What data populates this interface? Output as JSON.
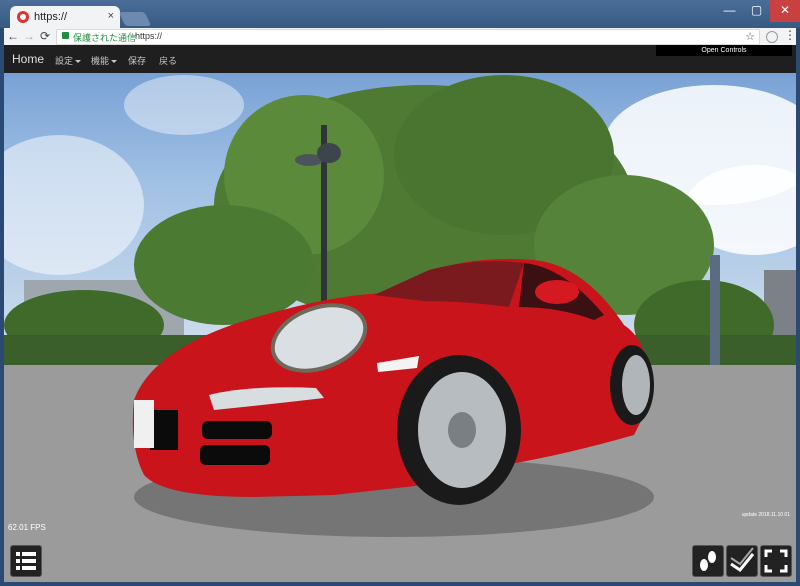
{
  "browser": {
    "tab_title": "https://",
    "tab_close": "×",
    "window_controls": {
      "minimize": "—",
      "maximize": "▢",
      "close": "✕"
    },
    "nav": {
      "back": "←",
      "forward": "→",
      "reload": "⟳"
    },
    "security_label": "保護された通信",
    "url": "https://",
    "star": "☆",
    "menu": "⋮"
  },
  "navbar": {
    "brand": "Home",
    "menu_settings": "設定",
    "menu_functions": "機能",
    "menu_save": "保存",
    "menu_back": "戻る",
    "controls_button": "Open Controls"
  },
  "viewer": {
    "fps": "62.01 FPS",
    "update": "update 2018.11.10 01",
    "bottom_left_icon": "menu-list-icon",
    "bottom_right_icons": [
      "footsteps-icon",
      "camera-path-icon",
      "fullscreen-icon"
    ]
  }
}
